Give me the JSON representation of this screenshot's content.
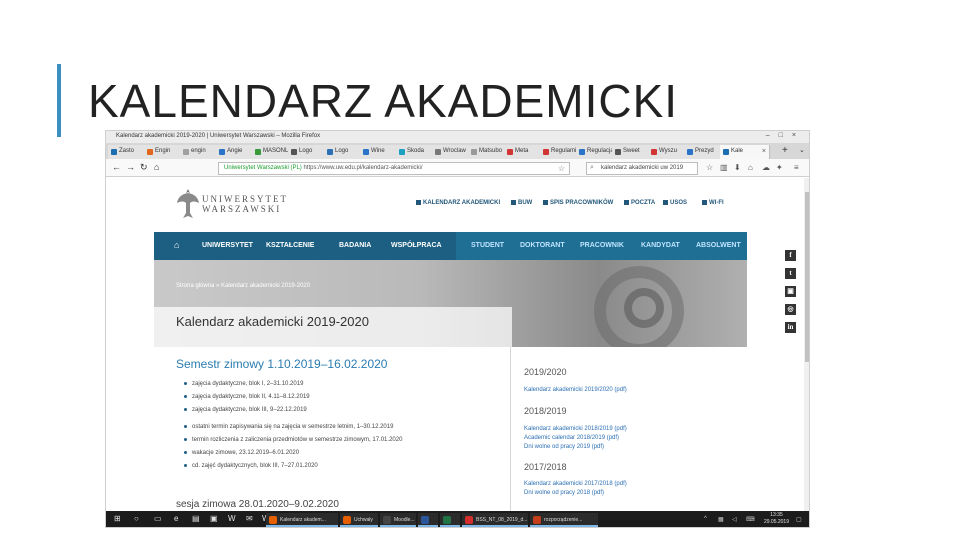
{
  "slide": {
    "title": "KALENDARZ AKADEMICKI"
  },
  "browser": {
    "window_title": "Kalendarz akademicki 2019-2020 | Uniwersytet Warszawski – Mozilla Firefox",
    "tabs": [
      {
        "label": "Zasto",
        "color": "#1b6fb0"
      },
      {
        "label": "Engin",
        "color": "#e0671e"
      },
      {
        "label": "engin",
        "color": "#a0a0a0"
      },
      {
        "label": "Angie",
        "color": "#2b73c8"
      },
      {
        "label": "MASONL",
        "color": "#3a9a3a"
      },
      {
        "label": "Logo",
        "color": "#555"
      },
      {
        "label": "Logo",
        "color": "#2d6fb4"
      },
      {
        "label": "Wine",
        "color": "#2b73c8"
      },
      {
        "label": "Skoda",
        "color": "#20a0c0"
      },
      {
        "label": "Wroclaw",
        "color": "#777"
      },
      {
        "label": "Matsubo",
        "color": "#999"
      },
      {
        "label": "Meta",
        "color": "#d03434"
      },
      {
        "label": "Regulamin",
        "color": "#d03434"
      },
      {
        "label": "Regulacja",
        "color": "#2b73c8"
      },
      {
        "label": "Sweet",
        "color": "#555"
      },
      {
        "label": "Wyszu",
        "color": "#d03434"
      },
      {
        "label": "Prezyd",
        "color": "#2b73c8"
      },
      {
        "label": "Kale",
        "color": "#1b6fb0"
      }
    ],
    "url_org": "Uniwersytet Warszawski (PL)",
    "url": "https://www.uw.edu.pl/kalendarz-akademicki/",
    "search": "kalendarz akademicki uw 2019",
    "new_tab": "+",
    "tab_list": "⌄"
  },
  "site": {
    "logo_line1": "UNIWERSYTET",
    "logo_line2": "WARSZAWSKI",
    "utility": [
      "KALENDARZ AKADEMICKI",
      "BUW",
      "SPIS PRACOWNIKÓW",
      "POCZTA",
      "USOS",
      "WI-FI"
    ],
    "nav_left": [
      "UNIWERSYTET",
      "KSZTAŁCENIE",
      "BADANIA",
      "WSPÓŁPRACA"
    ],
    "nav_right": [
      "STUDENT",
      "DOKTORANT",
      "PRACOWNIK",
      "KANDYDAT",
      "ABSOLWENT"
    ],
    "breadcrumb": "Strona główna  »  Kalendarz akademicki 2019-2020",
    "page_title": "Kalendarz akademicki 2019-2020",
    "semester_title": "Semestr zimowy 1.10.2019–16.02.2020",
    "bullets": [
      "zajęcia dydaktyczne, blok I, 2–31.10.2019",
      "zajęcia dydaktyczne, blok II, 4.11–8.12.2019",
      "zajęcia dydaktyczne, blok III, 9–22.12.2019",
      "ostatni termin zapisywania się na zajęcia w semestrze letnim, 1–30.12.2019",
      "termin rozliczenia z zaliczenia przedmiotów w semestrze zimowym, 17.01.2020",
      "wakacje zimowe, 23.12.2019–6.01.2020",
      "cd. zajęć dydaktycznych, blok III, 7–27.01.2020"
    ],
    "next_semester": "sesja zimowa 28.01.2020–9.02.2020",
    "side": [
      {
        "year": "2019/2020",
        "links": [
          "Kalendarz akademicki 2019/2020 (pdf)"
        ]
      },
      {
        "year": "2018/2019",
        "links": [
          "Kalendarz akademicki 2018/2019 (pdf)",
          "Academic calendar 2018/2019 (pdf)",
          "Dni wolne od pracy 2019 (pdf)"
        ]
      },
      {
        "year": "2017/2018",
        "links": [
          "Kalendarz akademicki 2017/2018 (pdf)",
          "Dni wolne od pracy 2018 (pdf)"
        ]
      }
    ],
    "social": [
      "f",
      "t",
      "▣",
      "◎",
      "in"
    ]
  },
  "taskbar": {
    "buttons": [
      {
        "label": "Kalendarz akadem...",
        "color": "#e66000"
      },
      {
        "label": "Uchwały",
        "color": "#e66000"
      },
      {
        "label": "Moodle...",
        "color": "#444"
      },
      {
        "label": "",
        "color": "#2b579a"
      },
      {
        "label": "",
        "color": "#217346"
      },
      {
        "label": "BSS_NT_08_2019_d...",
        "color": "#d32f2f"
      },
      {
        "label": "rozporządzenie...",
        "color": "#c43e1c"
      }
    ],
    "time": "13:35",
    "date": "29.05.2019"
  }
}
